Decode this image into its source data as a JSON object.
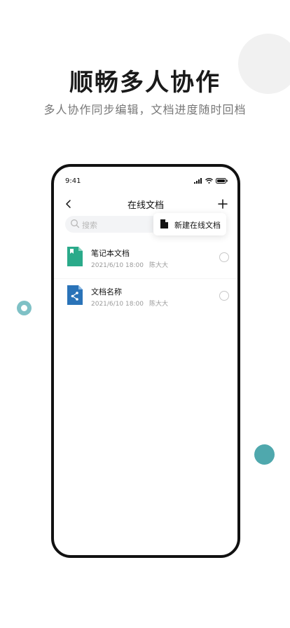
{
  "hero": {
    "title": "顺畅多人协作",
    "subtitle": "多人协作同步编辑，文档进度随时回档"
  },
  "phone": {
    "status_bar": {
      "time": "9:41"
    },
    "nav": {
      "title": "在线文档",
      "back_icon": "chevron-left-icon",
      "add_icon": "plus-icon"
    },
    "search": {
      "placeholder": "搜索",
      "icon": "search-icon"
    },
    "popup_menu": {
      "item_label": "新建在线文档",
      "icon": "document-icon"
    },
    "documents": [
      {
        "name": "笔记本文档",
        "date": "2021/6/10 18:00",
        "author": "陈大大",
        "icon": "bookmark-document-icon",
        "icon_color": "#2aaa8a"
      },
      {
        "name": "文档名称",
        "date": "2021/6/10 18:00",
        "author": "陈大大",
        "icon": "share-document-icon",
        "icon_color": "#2a73b8"
      }
    ]
  },
  "colors": {
    "teal_dot": "#4fa8ad",
    "ring_dot": "#7fc1c6",
    "gray_circle": "#f1f1f1"
  }
}
